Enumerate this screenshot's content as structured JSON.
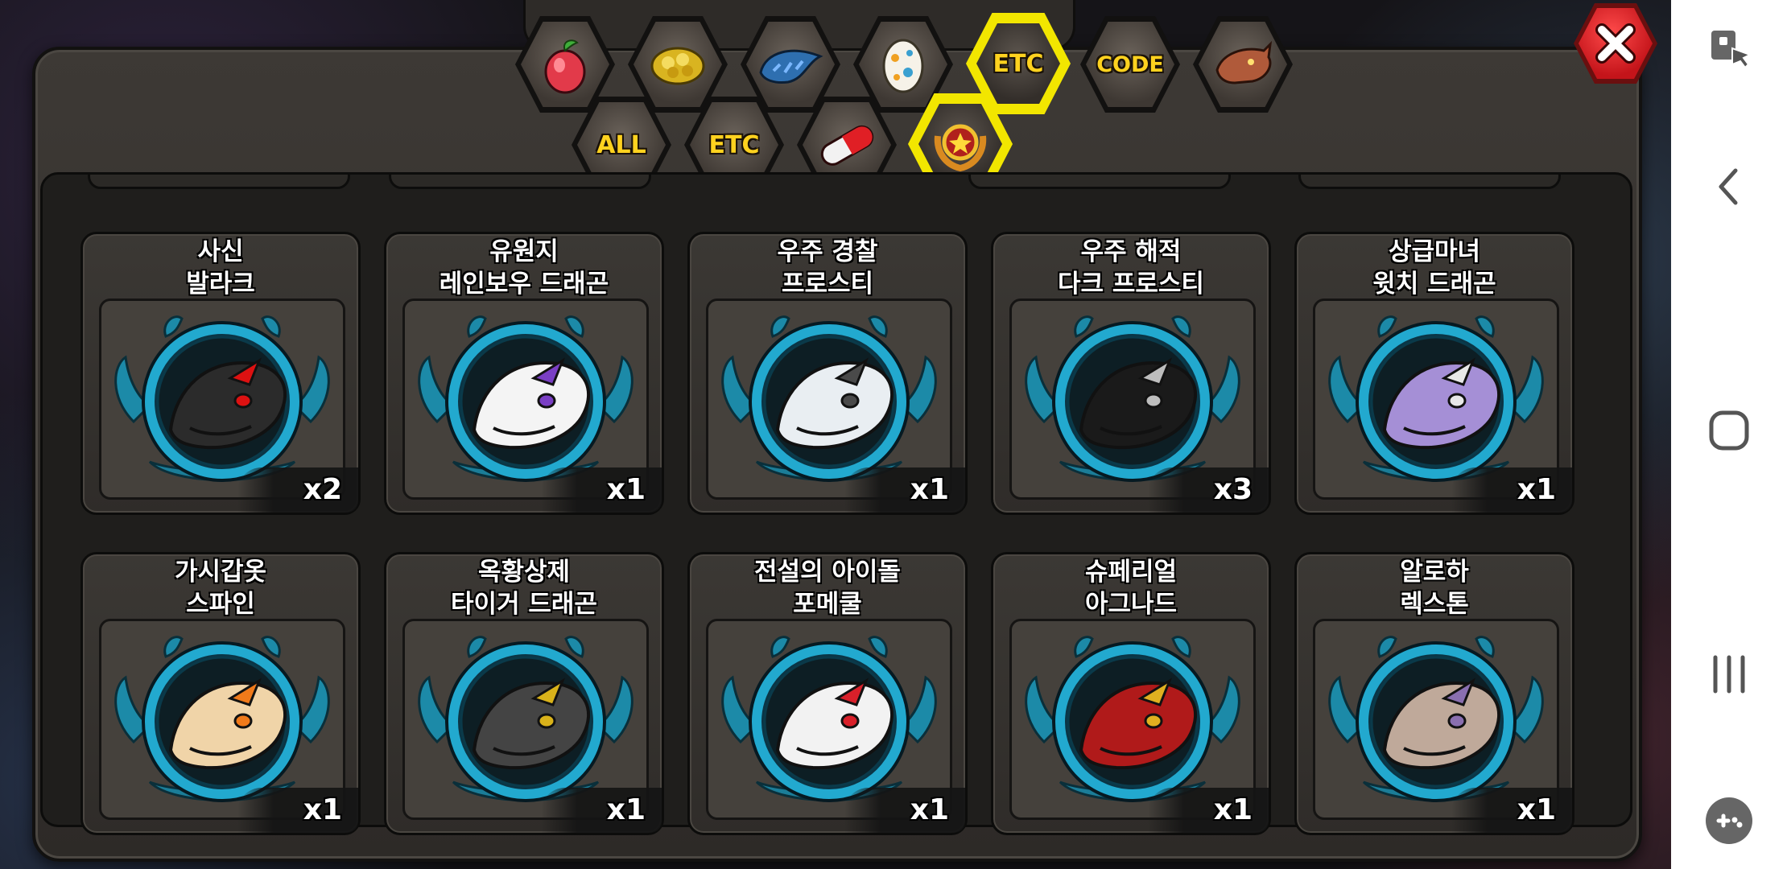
{
  "tabs_row1": [
    {
      "id": "fruit",
      "icon": "fruit-icon"
    },
    {
      "id": "gold",
      "icon": "gold-coins-icon"
    },
    {
      "id": "scale",
      "icon": "dragon-scale-icon"
    },
    {
      "id": "egg",
      "icon": "egg-icon"
    },
    {
      "id": "etc-top",
      "label": "ETC",
      "active": true
    },
    {
      "id": "code",
      "label": "CODE"
    },
    {
      "id": "beast",
      "icon": "dragon-head-icon"
    }
  ],
  "tabs_row2": [
    {
      "id": "all",
      "label": "ALL"
    },
    {
      "id": "etc",
      "label": "ETC"
    },
    {
      "id": "pill",
      "icon": "capsule-icon"
    },
    {
      "id": "medal",
      "icon": "star-medal-icon",
      "active": true
    }
  ],
  "items": [
    {
      "line1": "사신",
      "line2": "발라크",
      "qty": "x2",
      "color": "#2b2b2b",
      "accent": "#d11"
    },
    {
      "line1": "유원지",
      "line2": "레인보우 드래곤",
      "qty": "x1",
      "color": "#f4f4f4",
      "accent": "#7a3fc4"
    },
    {
      "line1": "우주 경찰",
      "line2": "프로스티",
      "qty": "x1",
      "color": "#e9eef2",
      "accent": "#4a4a4a"
    },
    {
      "line1": "우주 해적",
      "line2": "다크 프로스티",
      "qty": "x3",
      "color": "#1a1a1a",
      "accent": "#bdbdbd"
    },
    {
      "line1": "상급마녀",
      "line2": "윗치 드래곤",
      "qty": "x1",
      "color": "#a58fd6",
      "accent": "#e8e8e8"
    },
    {
      "line1": "가시갑옷",
      "line2": "스파인",
      "qty": "x1",
      "color": "#f0d4a8",
      "accent": "#f07a1a"
    },
    {
      "line1": "옥황상제",
      "line2": "타이거 드래곤",
      "qty": "x1",
      "color": "#444",
      "accent": "#d9b21a"
    },
    {
      "line1": "전설의 아이돌",
      "line2": "포메쿨",
      "qty": "x1",
      "color": "#f2f2f2",
      "accent": "#d9202a"
    },
    {
      "line1": "슈페리얼",
      "line2": "아그나드",
      "qty": "x1",
      "color": "#b01a1a",
      "accent": "#e0b020"
    },
    {
      "line1": "알로하",
      "line2": "렉스톤",
      "qty": "x1",
      "color": "#bfa99a",
      "accent": "#8a6fb0"
    }
  ],
  "nav": {
    "items": [
      "touch-lock-icon",
      "back-icon",
      "home-icon",
      "recents-icon",
      "game-tools-icon"
    ]
  }
}
